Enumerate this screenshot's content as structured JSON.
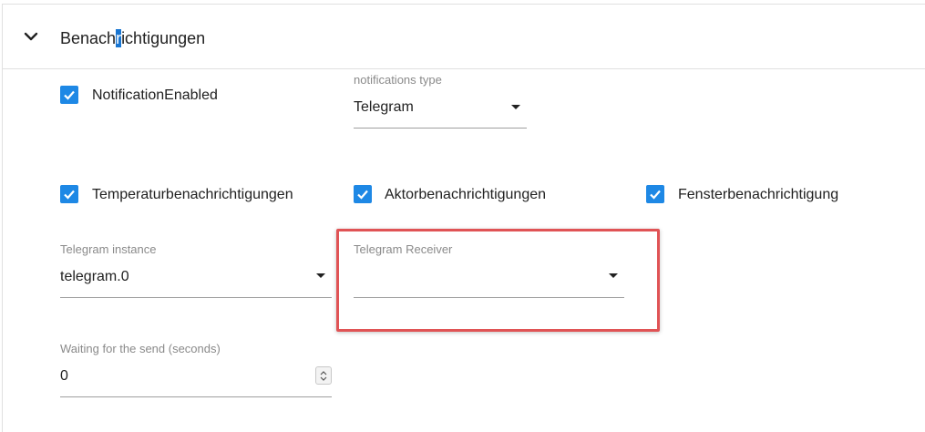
{
  "panel": {
    "title_before": "Benach",
    "title_selected": "r",
    "title_after": "ichtigungen"
  },
  "notification_enabled": {
    "label": "NotificationEnabled",
    "checked": true
  },
  "notifications_type": {
    "label": "notifications type",
    "value": "Telegram"
  },
  "checkboxes": [
    {
      "label": "Temperaturbenachrichtigungen",
      "checked": true
    },
    {
      "label": "Aktorbenachrichtigungen",
      "checked": true
    },
    {
      "label": "Fensterbenachrichtigung",
      "checked": true
    }
  ],
  "telegram_instance": {
    "label": "Telegram instance",
    "value": "telegram.0"
  },
  "telegram_receiver": {
    "label": "Telegram Receiver",
    "value": ""
  },
  "waiting_send": {
    "label": "Waiting for the send (seconds)",
    "value": "0"
  },
  "colors": {
    "accent": "#1e88e5",
    "highlight": "#e05355"
  }
}
